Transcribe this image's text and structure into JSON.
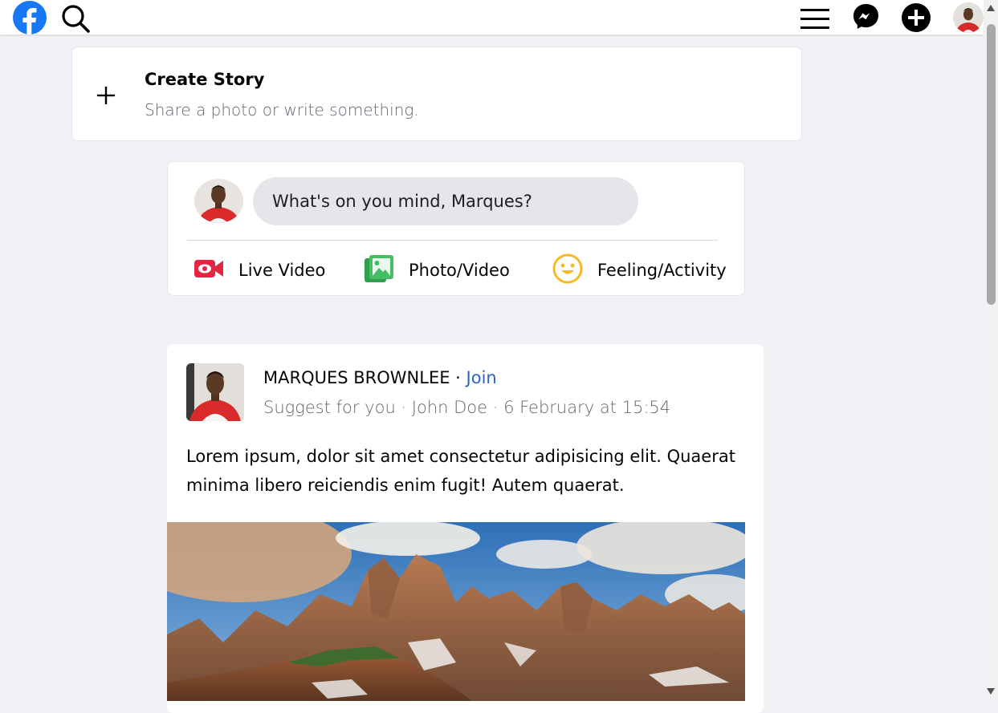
{
  "colors": {
    "brand_blue": "#1877f2",
    "link_blue": "#2d64bc",
    "live_red": "#e42645",
    "photo_green": "#45bd62",
    "feeling_yellow": "#f7b928",
    "page_bg": "#f0f2f5"
  },
  "topbar": {
    "icons": [
      "facebook-logo-icon",
      "search-icon",
      "menu-icon",
      "messenger-icon",
      "plus-icon",
      "avatar"
    ]
  },
  "story": {
    "title": "Create Story",
    "subtitle": "Share a photo or write something.",
    "icon": "plus-icon"
  },
  "composer": {
    "placeholder": "What's on you mind, Marques?",
    "actions": [
      {
        "label": "Live Video",
        "icon": "live-video-icon"
      },
      {
        "label": "Photo/Video",
        "icon": "photo-video-icon"
      },
      {
        "label": "Feeling/Activity",
        "icon": "feeling-icon"
      }
    ]
  },
  "post": {
    "author": "MARQUES BROWNLEE",
    "separator": " · ",
    "join": "Join",
    "meta": "Suggest for you · John Doe · 6 February at 15:54",
    "text": "Lorem ipsum, dolor sit amet consectetur adipisicing elit. Quaerat minima libero reiciendis enim fugit! Autem quaerat."
  }
}
